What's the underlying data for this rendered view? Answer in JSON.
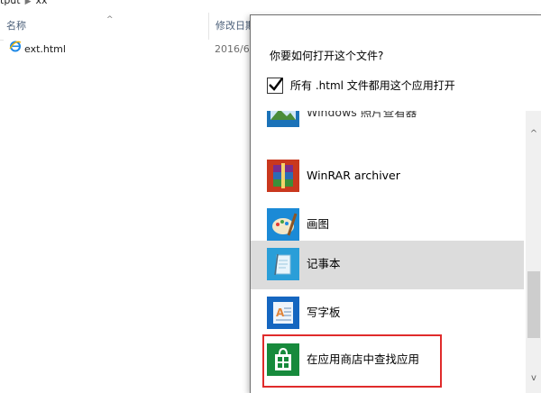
{
  "explorer": {
    "breadcrumb": [
      "tput",
      "xx"
    ],
    "columns": {
      "name": "名称",
      "date": "修改日期"
    },
    "file": {
      "name": "ext.html",
      "date": "2016/6/"
    }
  },
  "dialog": {
    "title": "你要如何打开这个文件?",
    "always_use_label": "所有 .html 文件都用这个应用打开",
    "always_use_checked": true,
    "apps": [
      {
        "label": "Windows 照片查看器",
        "icon": "photos-viewer-icon"
      },
      {
        "label": "WinRAR archiver",
        "icon": "winrar-icon"
      },
      {
        "label": "画图",
        "icon": "paint-icon"
      },
      {
        "label": "记事本",
        "icon": "notepad-icon",
        "selected": true
      },
      {
        "label": "写字板",
        "icon": "wordpad-icon"
      },
      {
        "label": "在应用商店中查找应用",
        "icon": "store-icon"
      }
    ],
    "highlight_color": "#e02b2b",
    "selected_bg": "#dcdcdc"
  }
}
